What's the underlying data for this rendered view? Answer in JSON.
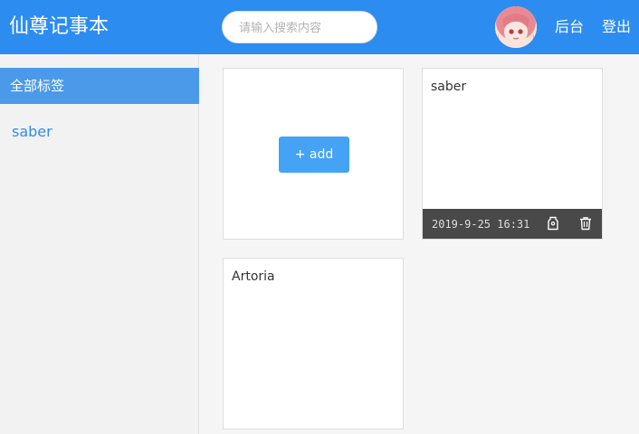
{
  "header": {
    "title": "仙尊记事本",
    "search_placeholder": "请输入搜索内容",
    "search_value": "",
    "nav": [
      "后台",
      "登出"
    ]
  },
  "sidebar": {
    "header": "全部标签",
    "tags": [
      "saber"
    ]
  },
  "cards": {
    "add_label": "+ add",
    "notes": [
      {
        "text": "saber",
        "date": "2019-9-25 16:31"
      },
      {
        "text": "Artoria"
      }
    ]
  },
  "colors": {
    "header_bg": "#2d8cf0",
    "sidebar_active_bg": "#4a9ae9",
    "add_button": "#44a3f5",
    "card_footer": "#494949"
  },
  "icons": [
    "avatar",
    "tag-icon",
    "trash-icon"
  ]
}
